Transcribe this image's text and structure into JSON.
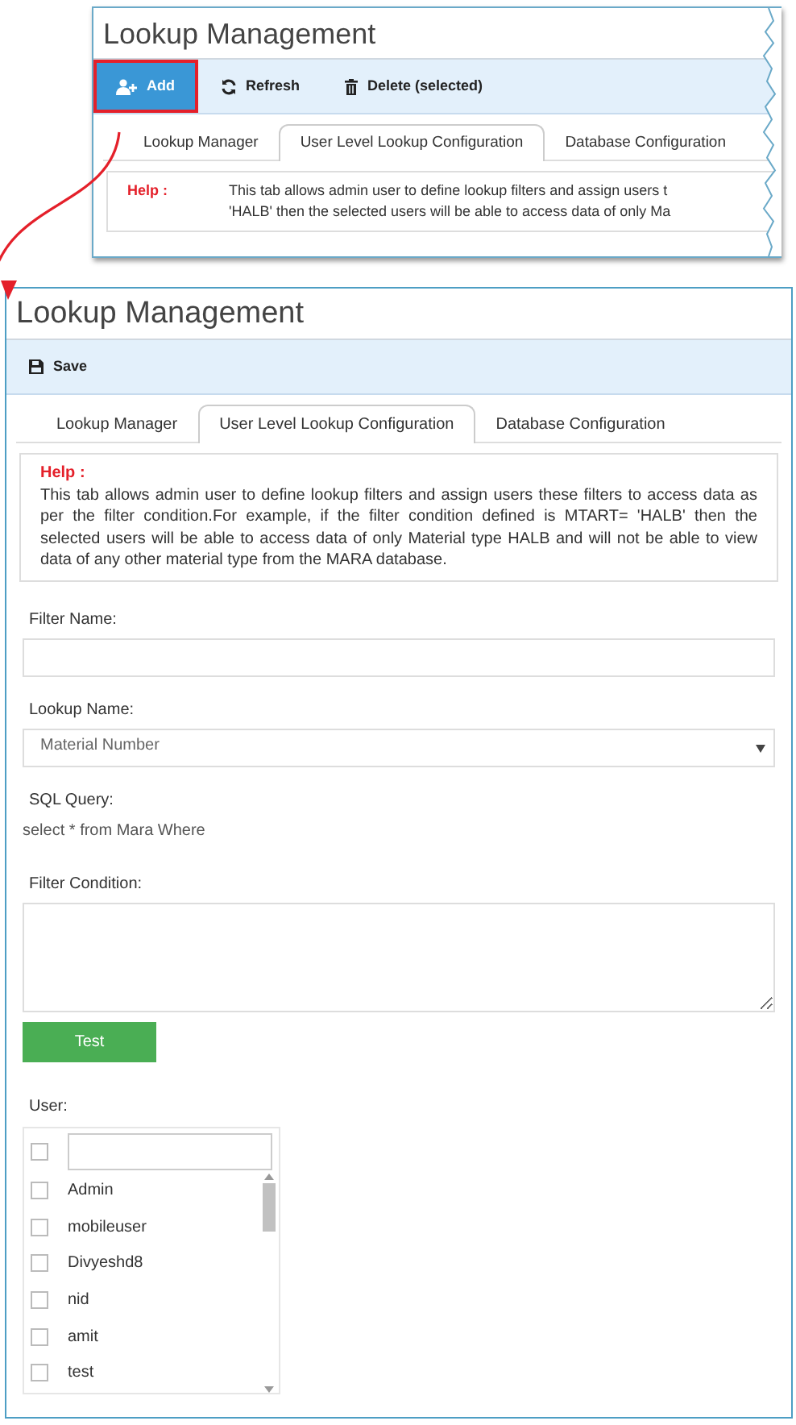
{
  "inset": {
    "title": "Lookup Management",
    "toolbar": [
      {
        "label": "Add",
        "kind": "add",
        "primary": true,
        "highlighted": true
      },
      {
        "label": "Refresh",
        "kind": "refresh",
        "primary": false,
        "highlighted": false
      },
      {
        "label": "Delete (selected)",
        "kind": "delete",
        "primary": false,
        "highlighted": false
      }
    ],
    "tabs": [
      {
        "label": "Lookup Manager",
        "selected": false
      },
      {
        "label": "User Level Lookup Configuration",
        "selected": true
      },
      {
        "label": "Database Configuration",
        "selected": false
      }
    ],
    "help_label": "Help :",
    "help_lines": [
      "This tab allows admin user to define lookup filters and assign users t",
      "'HALB' then the selected users will be able to access data of only Ma"
    ]
  },
  "page": {
    "title": "Lookup Management",
    "toolbar": [
      {
        "label": "Save",
        "kind": "save",
        "primary": false,
        "highlighted": false
      }
    ],
    "tabs": [
      {
        "label": "Lookup Manager",
        "selected": false
      },
      {
        "label": "User Level Lookup Configuration",
        "selected": true
      },
      {
        "label": "Database Configuration",
        "selected": false
      }
    ],
    "help_label": "Help :",
    "help_text": "This tab allows admin user to define lookup filters and assign users these filters to access data as per the filter condition.For example, if the filter condition defined is MTART= 'HALB' then the selected users will be able to access data of only Material type HALB and will not be able to view data of any other material type from the MARA database.",
    "filter_name_label": "Filter Name:",
    "lookup_name_label": "Lookup Name:",
    "lookup_name_value": "Material Number",
    "sql_query_label": "SQL Query:",
    "sql_query": "select * from Mara Where",
    "filter_condition_label": "Filter Condition:",
    "test_button": "Test",
    "user_label": "User:",
    "select_all_checked": false,
    "users": [
      {
        "name": "Admin",
        "checked": false
      },
      {
        "name": "mobileuser",
        "checked": false
      },
      {
        "name": "Divyeshd8",
        "checked": false
      },
      {
        "name": "nid",
        "checked": false
      },
      {
        "name": "amit",
        "checked": false
      },
      {
        "name": "test",
        "checked": false
      }
    ]
  }
}
